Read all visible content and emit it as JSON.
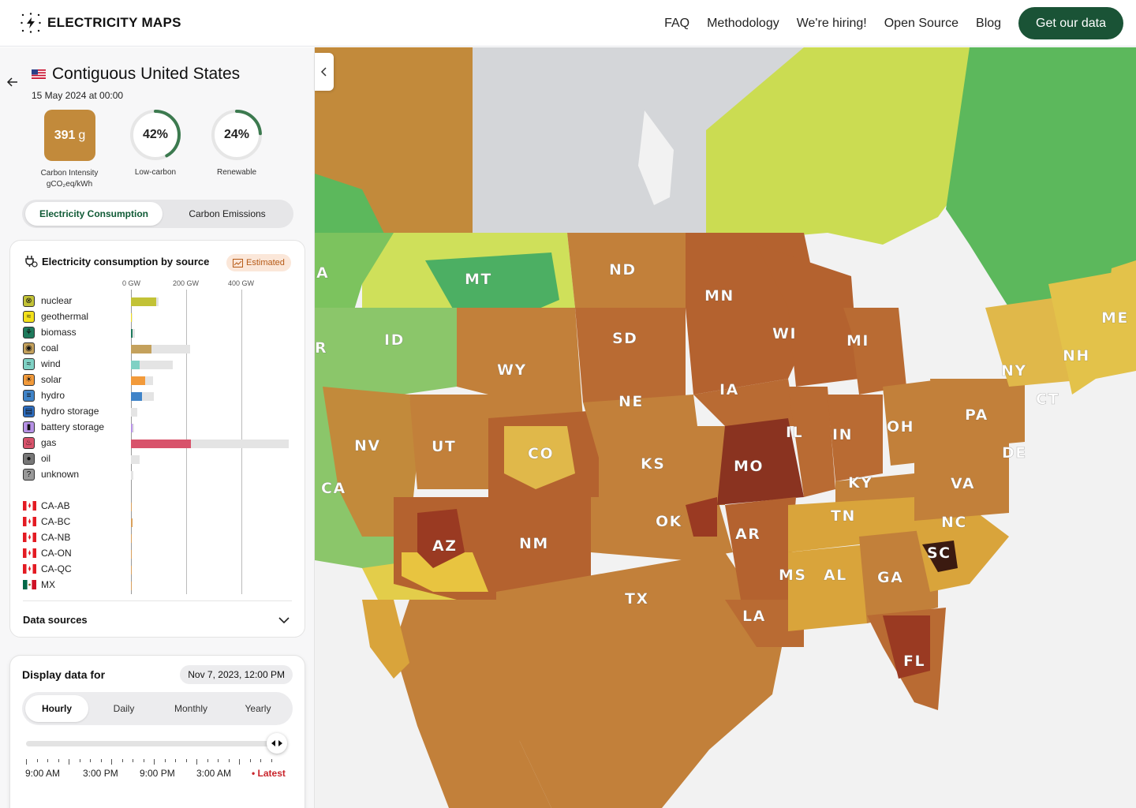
{
  "header": {
    "brand": "ELECTRICITY MAPS",
    "nav": [
      "FAQ",
      "Methodology",
      "We're hiring!",
      "Open Source",
      "Blog"
    ],
    "cta": "Get our data"
  },
  "zone": {
    "name": "Contiguous United States",
    "date": "15 May 2024 at 00:00",
    "carbon_value": "391",
    "carbon_unit": "g",
    "carbon_label": "Carbon Intensity",
    "carbon_sublabel": "gCO₂eq/kWh",
    "low_carbon": "42%",
    "low_carbon_label": "Low-carbon",
    "low_carbon_fraction": 0.42,
    "renewable": "24%",
    "renewable_label": "Renewable",
    "renewable_fraction": 0.24,
    "accent": "#c28a3b"
  },
  "toggle": {
    "consumption": "Electricity Consumption",
    "emissions": "Carbon Emissions"
  },
  "breakdown": {
    "title": "Electricity consumption by source",
    "badge": "Estimated",
    "axis": [
      "0 GW",
      "200 GW",
      "400 GW"
    ],
    "data_sources": "Data sources",
    "sources": [
      {
        "name": "nuclear",
        "icon": "atom-icon",
        "color": "#c2c236",
        "value": 92,
        "capacity": 100
      },
      {
        "name": "geothermal",
        "icon": "heat-icon",
        "color": "#f2e01a",
        "value": 2,
        "capacity": 4
      },
      {
        "name": "biomass",
        "icon": "leaf-icon",
        "color": "#1e7a5c",
        "value": 5,
        "capacity": 14
      },
      {
        "name": "coal",
        "icon": "coal-icon",
        "color": "#c4a15c",
        "value": 75,
        "capacity": 215
      },
      {
        "name": "wind",
        "icon": "wind-icon",
        "color": "#7fd1c4",
        "value": 32,
        "capacity": 150
      },
      {
        "name": "solar",
        "icon": "sun-icon",
        "color": "#f29a3a",
        "value": 52,
        "capacity": 80
      },
      {
        "name": "hydro",
        "icon": "water-icon",
        "color": "#3f83c8",
        "value": 40,
        "capacity": 82
      },
      {
        "name": "hydro storage",
        "icon": "storage-icon",
        "color": "#2d6fc4",
        "value": 0,
        "capacity": 23
      },
      {
        "name": "battery storage",
        "icon": "battery-icon",
        "color": "#b792e6",
        "value": 6,
        "capacity": 12
      },
      {
        "name": "gas",
        "icon": "flame-icon",
        "color": "#d8536b",
        "value": 218,
        "capacity": 570
      },
      {
        "name": "oil",
        "icon": "drop-icon",
        "color": "#777777",
        "value": 0,
        "capacity": 30
      },
      {
        "name": "unknown",
        "icon": "question-icon",
        "color": "#999999",
        "value": 0,
        "capacity": 8
      }
    ],
    "exchanges": [
      {
        "name": "CA-AB",
        "flag": "ca",
        "value": 1
      },
      {
        "name": "CA-BC",
        "flag": "ca",
        "value": 2
      },
      {
        "name": "CA-NB",
        "flag": "ca",
        "value": 1
      },
      {
        "name": "CA-ON",
        "flag": "ca",
        "value": 1
      },
      {
        "name": "CA-QC",
        "flag": "ca",
        "value": 1
      },
      {
        "name": "MX",
        "flag": "mx",
        "value": 1
      }
    ]
  },
  "display": {
    "title": "Display data for",
    "date": "Nov 7, 2023, 12:00 PM",
    "options": [
      "Hourly",
      "Daily",
      "Monthly",
      "Yearly"
    ],
    "active": "Hourly",
    "ticks": [
      "9:00 AM",
      "3:00 PM",
      "9:00 PM",
      "3:00 AM"
    ],
    "latest": "Latest"
  },
  "map": {
    "labels": [
      "MT",
      "ND",
      "MN",
      "WI",
      "MI",
      "ME",
      "NH",
      "NY",
      "CT",
      "PA",
      "ID",
      "SD",
      "WY",
      "IA",
      "NE",
      "OH",
      "IN",
      "IL",
      "NV",
      "UT",
      "CO",
      "KS",
      "MO",
      "KY",
      "DE",
      "VA",
      "TN",
      "NC",
      "OK",
      "AR",
      "AZ",
      "NM",
      "SC",
      "MS",
      "AL",
      "GA",
      "TX",
      "LA",
      "FL",
      "CA",
      "A",
      "R"
    ]
  }
}
